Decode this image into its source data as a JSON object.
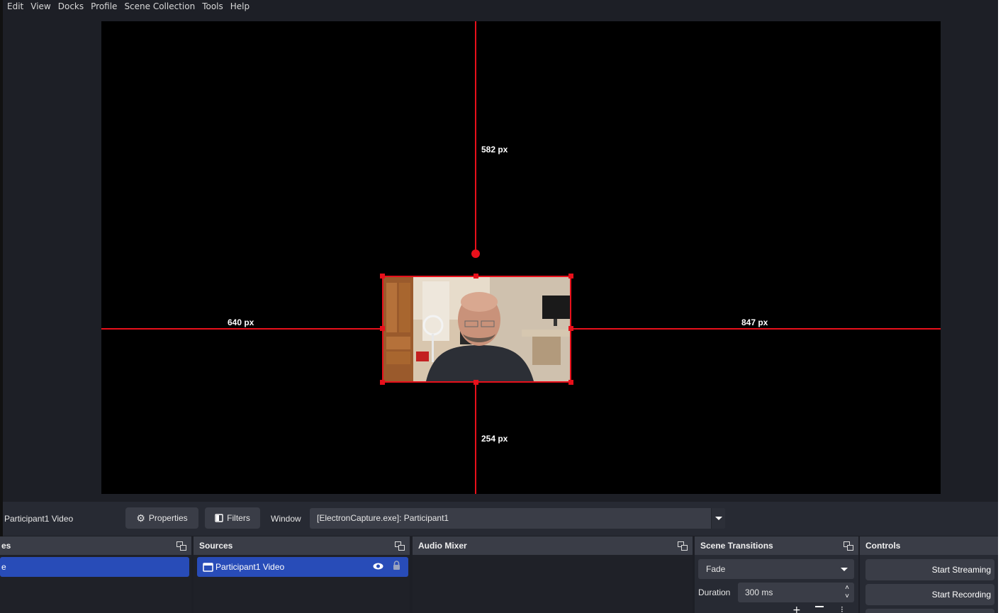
{
  "menu": [
    "Edit",
    "View",
    "Docks",
    "Profile",
    "Scene Collection",
    "Tools",
    "Help"
  ],
  "preview": {
    "distance_top": "582 px",
    "distance_left": "640 px",
    "distance_right": "847 px",
    "distance_bottom": "254 px",
    "guide_color": "#e8101b"
  },
  "context_bar": {
    "source_name": "Participant1 Video",
    "properties_label": "Properties",
    "filters_label": "Filters",
    "window_label": "Window",
    "window_value": "[ElectronCapture.exe]: Participant1"
  },
  "docks": {
    "scenes": {
      "title": "es",
      "selected_item": "e"
    },
    "sources": {
      "title": "Sources",
      "items": [
        {
          "label": "Participant1 Video",
          "visible": true,
          "locked": true
        }
      ]
    },
    "audio_mixer": {
      "title": "Audio Mixer"
    },
    "scene_transitions": {
      "title": "Scene Transitions",
      "transition": "Fade",
      "duration_label": "Duration",
      "duration_value": "300 ms"
    },
    "controls": {
      "title": "Controls",
      "start_streaming": "Start Streaming",
      "start_recording": "Start Recording"
    }
  },
  "colors": {
    "accent": "#284cb8",
    "panel": "#272a33",
    "header": "#3a3d47"
  }
}
